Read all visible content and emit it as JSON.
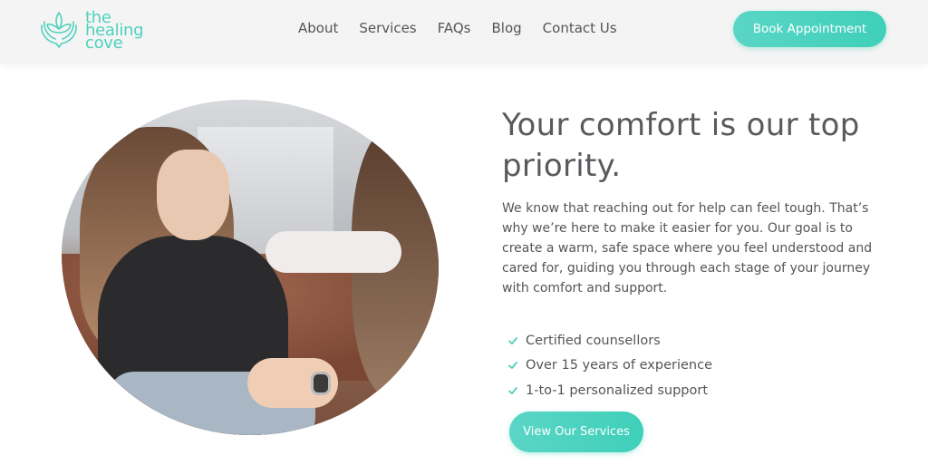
{
  "brand": {
    "logo_line1": "the",
    "logo_line2": "healing",
    "logo_line3": "cove",
    "accent": "#4fd1bd",
    "logo_icon": "hands-lotus-icon"
  },
  "nav": {
    "items": [
      "About",
      "Services",
      "FAQs",
      "Blog",
      "Contact Us"
    ]
  },
  "header": {
    "cta_label": "Book Appointment"
  },
  "hero": {
    "headline": "Your comfort is our top priority.",
    "paragraph": "We know that reaching out for help can feel tough. That’s why we’re here to make it easier for you. Our goal is to create a warm, safe space where you feel understood and cared for, guiding you through each stage of your journey with comfort and support.",
    "features": [
      "Certified counsellors",
      "Over 15 years of experience",
      "1-to-1 personalized support"
    ],
    "feature_icon": "check-icon",
    "button_label": "View Our Services"
  }
}
